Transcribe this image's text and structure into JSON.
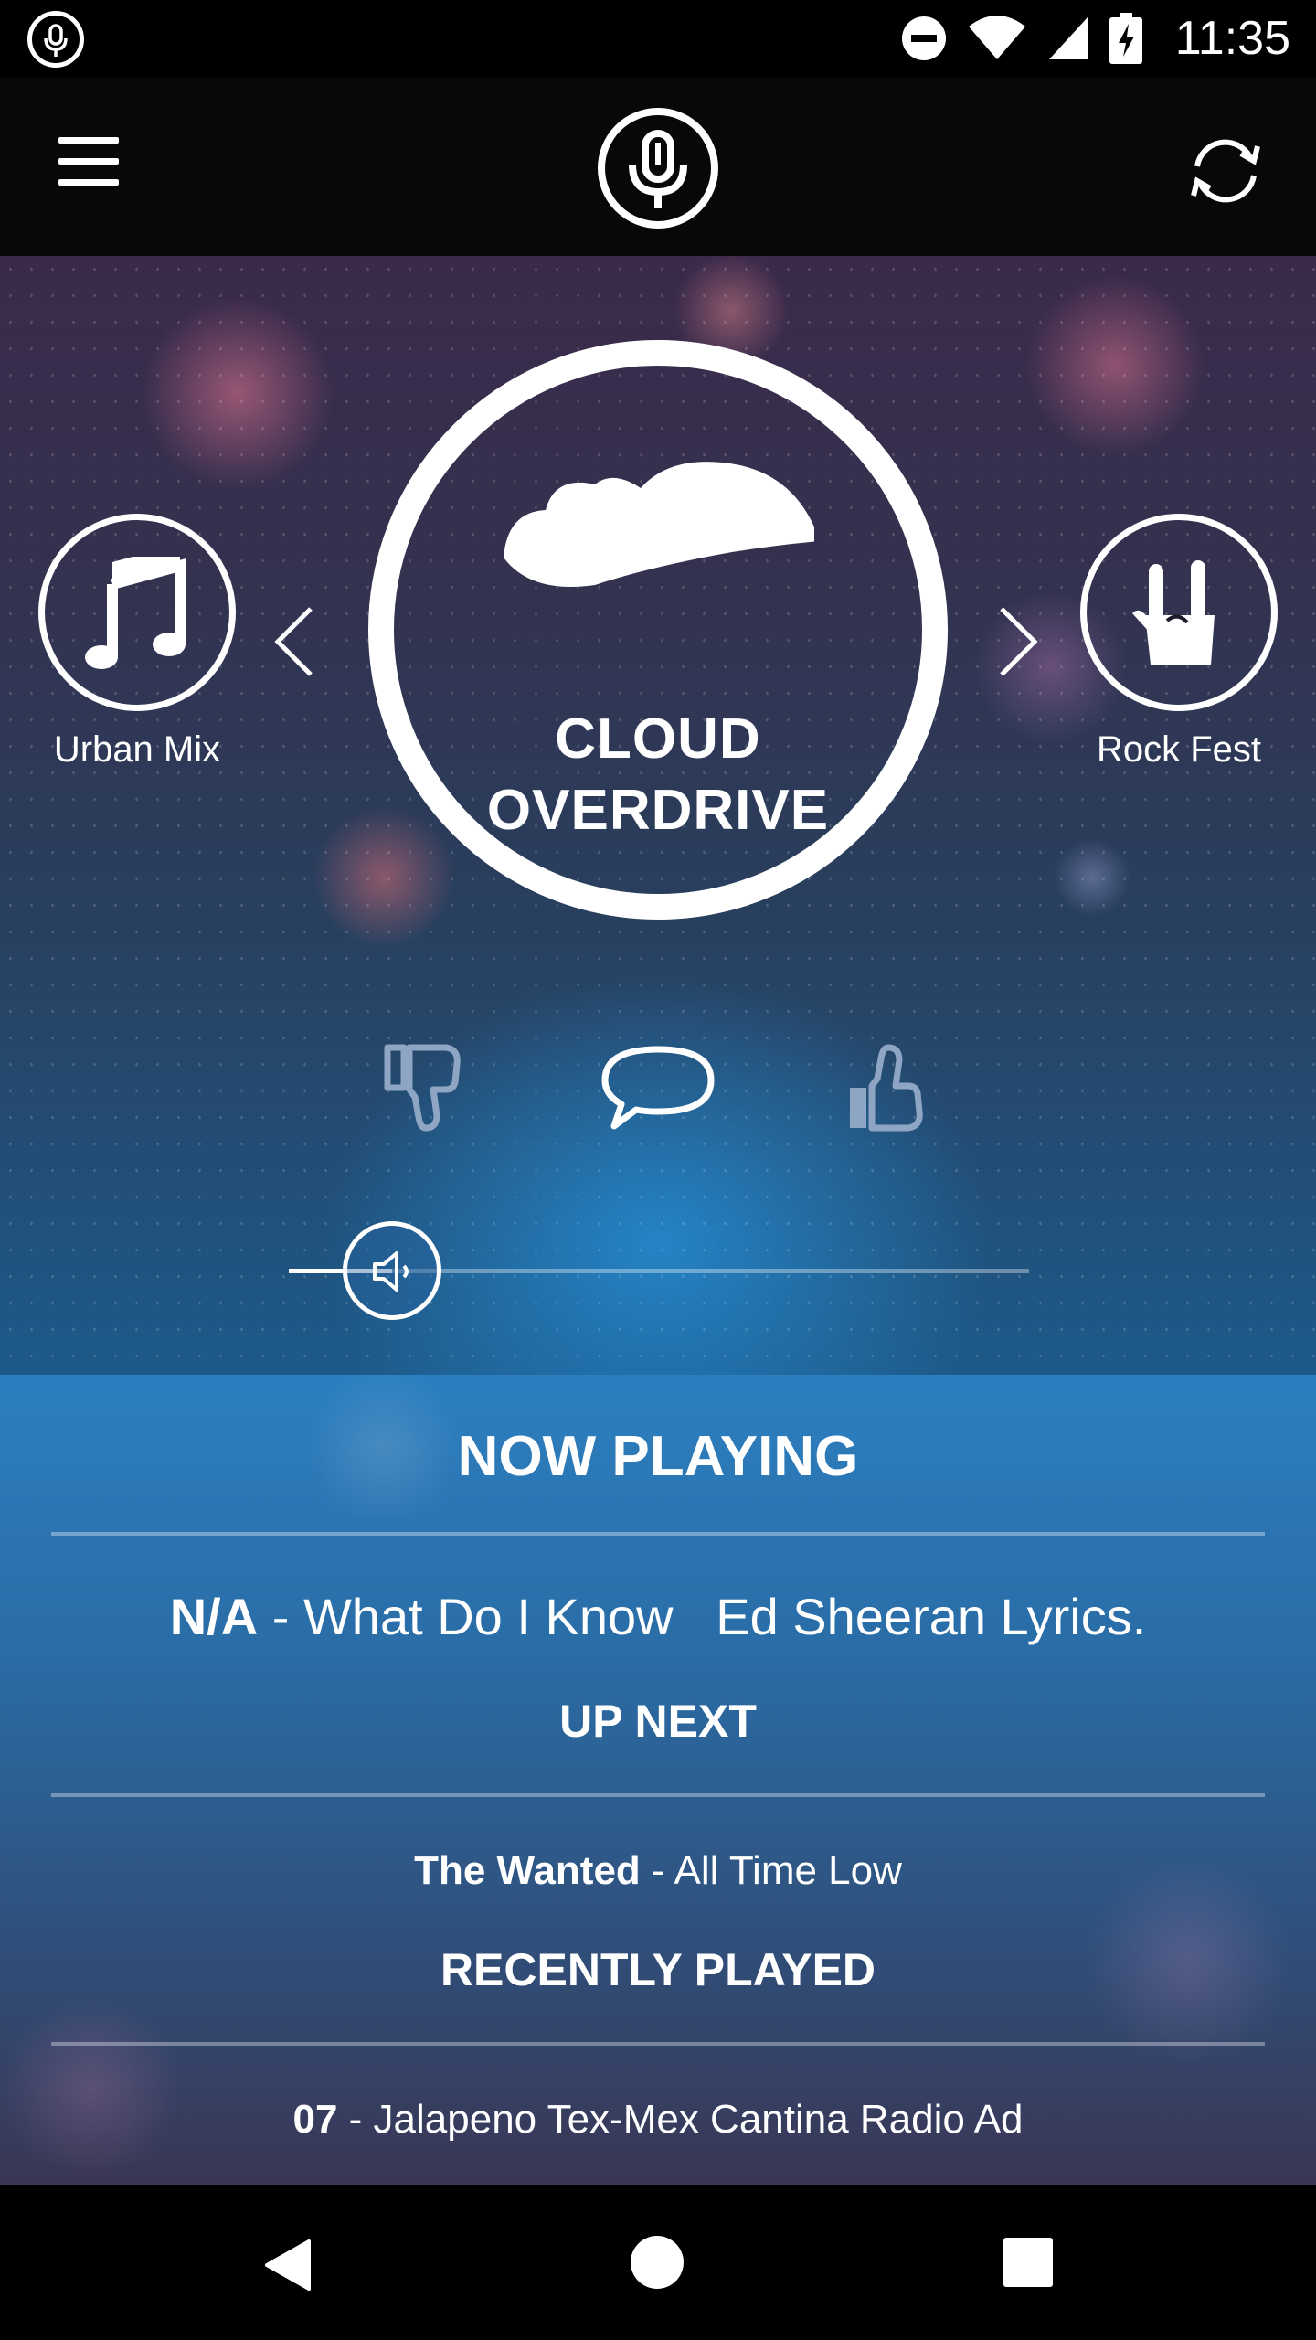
{
  "status_bar": {
    "time": "11:35",
    "icons": [
      "mic-notification-icon",
      "do-not-disturb-icon",
      "wifi-icon",
      "cell-signal-icon",
      "battery-charging-icon"
    ]
  },
  "app_bar": {
    "icons": [
      "menu-icon",
      "microphone-logo-icon",
      "refresh-icon"
    ]
  },
  "stations": {
    "previous": {
      "label": "Urban Mix",
      "icon": "music-note-icon"
    },
    "current": {
      "line1": "CLOUD",
      "line2": "OVERDRIVE",
      "icon": "cloud-icon"
    },
    "next": {
      "label": "Rock Fest",
      "icon": "rock-hand-icon"
    }
  },
  "feedback": {
    "icons": [
      "thumbs-down-icon",
      "chat-bubble-icon",
      "thumbs-up-icon"
    ]
  },
  "volume": {
    "level_fraction": 0.14,
    "icon": "speaker-icon"
  },
  "now_playing": {
    "heading": "NOW PLAYING",
    "artist": "N/A",
    "separator": " - ",
    "title": "What Do I Know   Ed Sheeran Lyrics."
  },
  "up_next": {
    "heading": "UP NEXT",
    "artist": "The Wanted",
    "separator": " - ",
    "title": "All Time Low"
  },
  "recently_played": {
    "heading": "RECENTLY PLAYED",
    "artist": "07",
    "separator": " - ",
    "title": "Jalapeno Tex-Mex Cantina Radio Ad"
  },
  "colors": {
    "accent_blue": "#2c7fbf",
    "background_dark": "#000000",
    "text": "#ffffff",
    "feedback_icon": "#8ea6c4"
  }
}
